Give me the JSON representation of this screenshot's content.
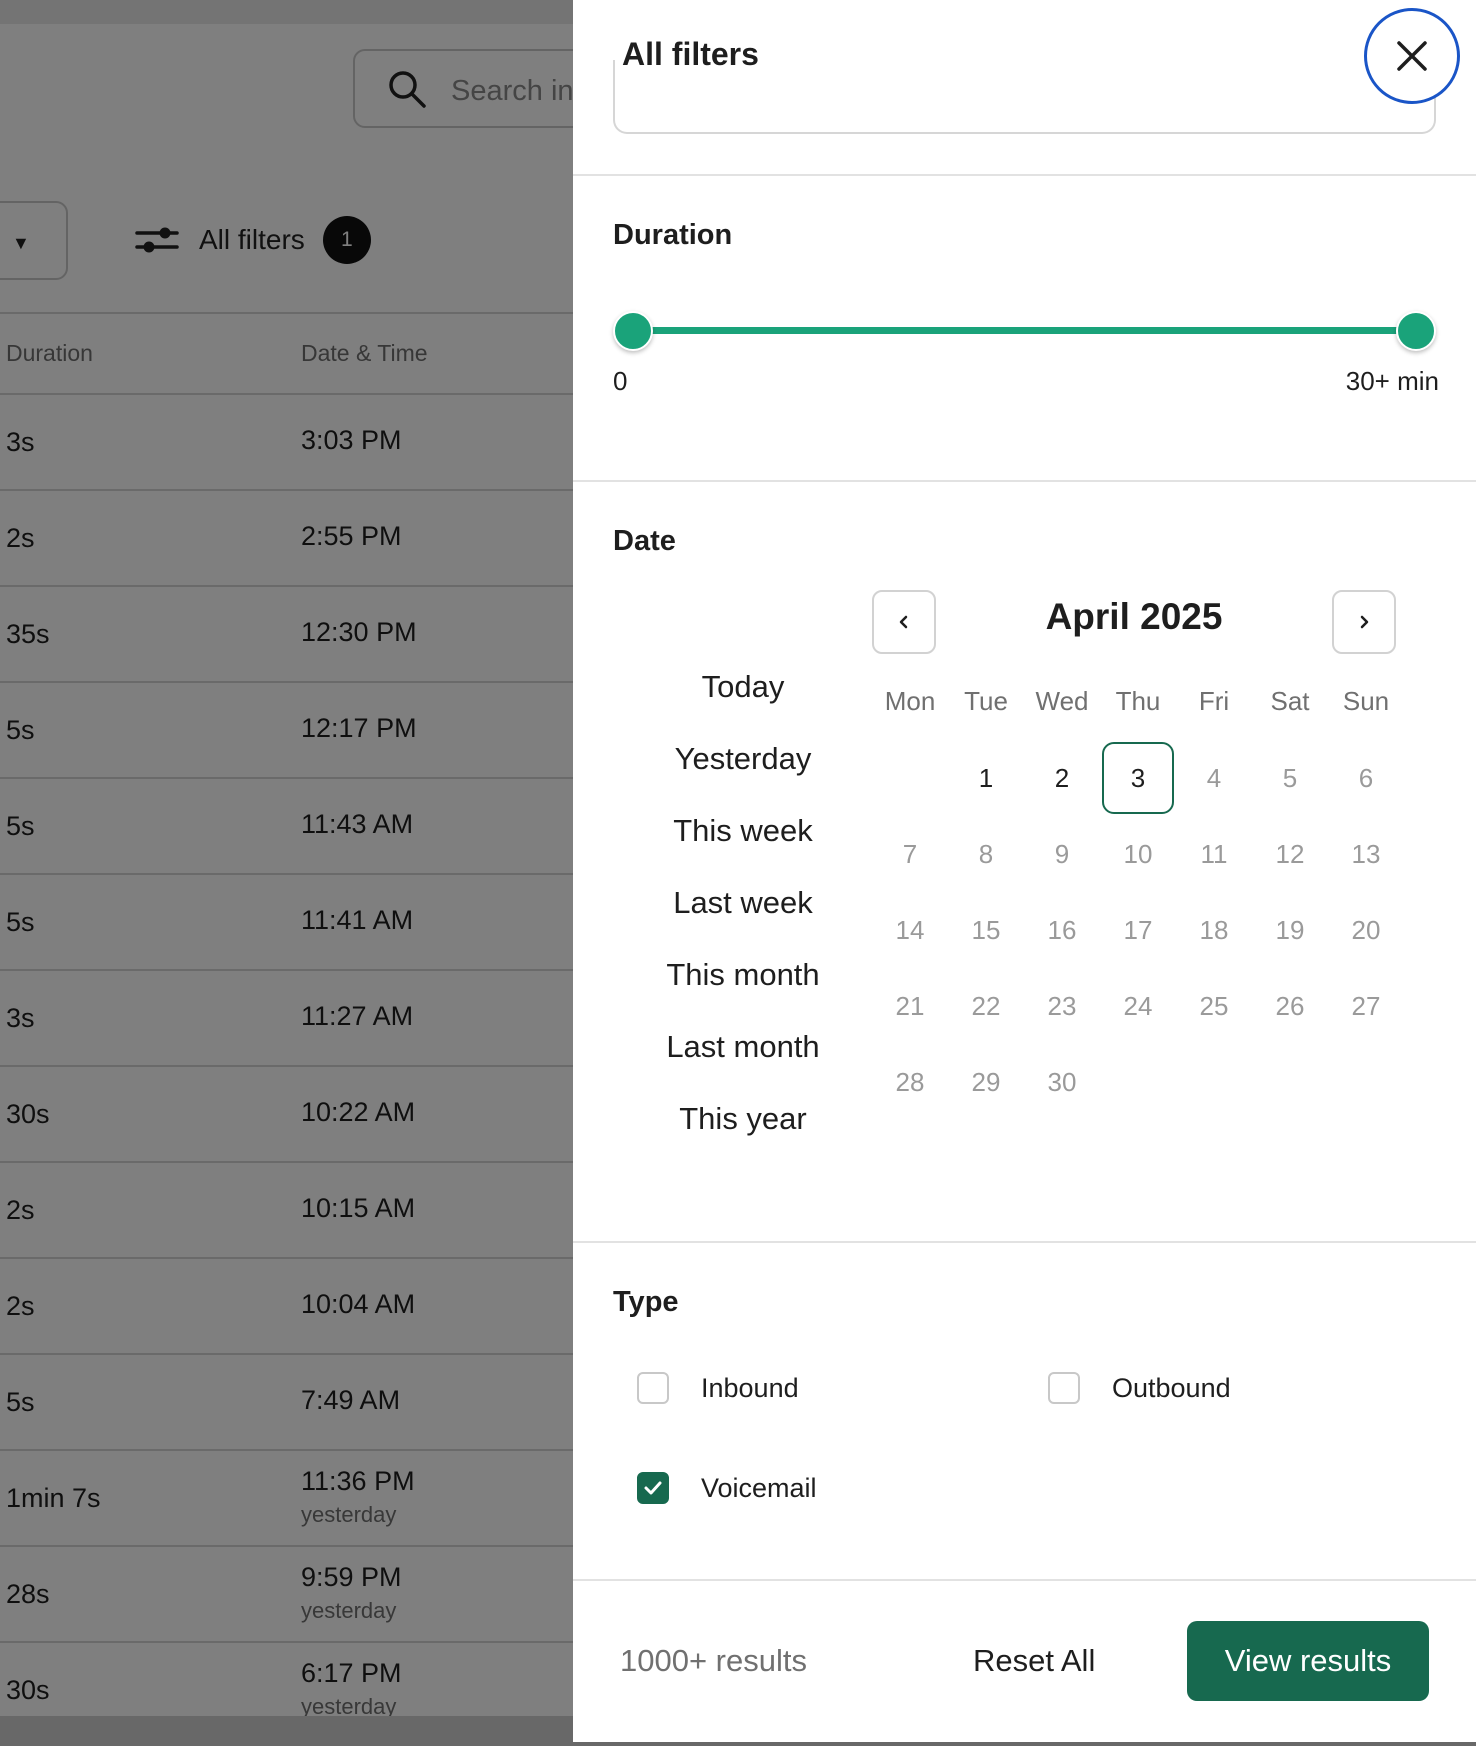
{
  "background": {
    "search_placeholder": "Search in",
    "filters_label": "All filters",
    "filters_count": "1",
    "columns": {
      "duration": "Duration",
      "date_time": "Date & Time"
    },
    "rows": [
      {
        "duration": "3s",
        "time": "3:03 PM",
        "when": ""
      },
      {
        "duration": "2s",
        "time": "2:55 PM",
        "when": ""
      },
      {
        "duration": "35s",
        "time": "12:30 PM",
        "when": ""
      },
      {
        "duration": "5s",
        "time": "12:17 PM",
        "when": ""
      },
      {
        "duration": "5s",
        "time": "11:43 AM",
        "when": ""
      },
      {
        "duration": "5s",
        "time": "11:41 AM",
        "when": ""
      },
      {
        "duration": "3s",
        "time": "11:27 AM",
        "when": ""
      },
      {
        "duration": "30s",
        "time": "10:22 AM",
        "when": ""
      },
      {
        "duration": "2s",
        "time": "10:15 AM",
        "when": ""
      },
      {
        "duration": "2s",
        "time": "10:04 AM",
        "when": ""
      },
      {
        "duration": "5s",
        "time": "7:49 AM",
        "when": ""
      },
      {
        "duration": "1min 7s",
        "time": "11:36 PM",
        "when": "yesterday"
      },
      {
        "duration": "28s",
        "time": "9:59 PM",
        "when": "yesterday"
      },
      {
        "duration": "30s",
        "time": "6:17 PM",
        "when": "yesterday"
      }
    ]
  },
  "drawer": {
    "title": "All filters",
    "duration": {
      "label": "Duration",
      "min_label": "0",
      "max_label": "30+ min",
      "selected_min_fraction": 0,
      "selected_max_fraction": 1
    },
    "date": {
      "label": "Date",
      "quick_ranges": [
        "Today",
        "Yesterday",
        "This week",
        "Last week",
        "This month",
        "Last month",
        "This year"
      ],
      "month": "April 2025",
      "weekdays": [
        "Mon",
        "Tue",
        "Wed",
        "Thu",
        "Fri",
        "Sat",
        "Sun"
      ],
      "first_weekday_offset": 1,
      "days_in_month": 30,
      "enabled_through_day": 3,
      "selected_day": 3
    },
    "type": {
      "label": "Type",
      "options": [
        {
          "label": "Inbound",
          "checked": false
        },
        {
          "label": "Outbound",
          "checked": false
        },
        {
          "label": "Voicemail",
          "checked": true
        }
      ]
    },
    "footer": {
      "results": "1000+ results",
      "reset": "Reset All",
      "view": "View results"
    }
  },
  "colors": {
    "accent": "#1aa37a",
    "primary": "#17694f",
    "focus_ring": "#1a55c7"
  },
  "icons": {
    "close": "close-icon",
    "prev": "chevron-left-icon",
    "next": "chevron-right-icon",
    "search": "search-icon",
    "filters": "sliders-icon",
    "check": "check-icon"
  }
}
